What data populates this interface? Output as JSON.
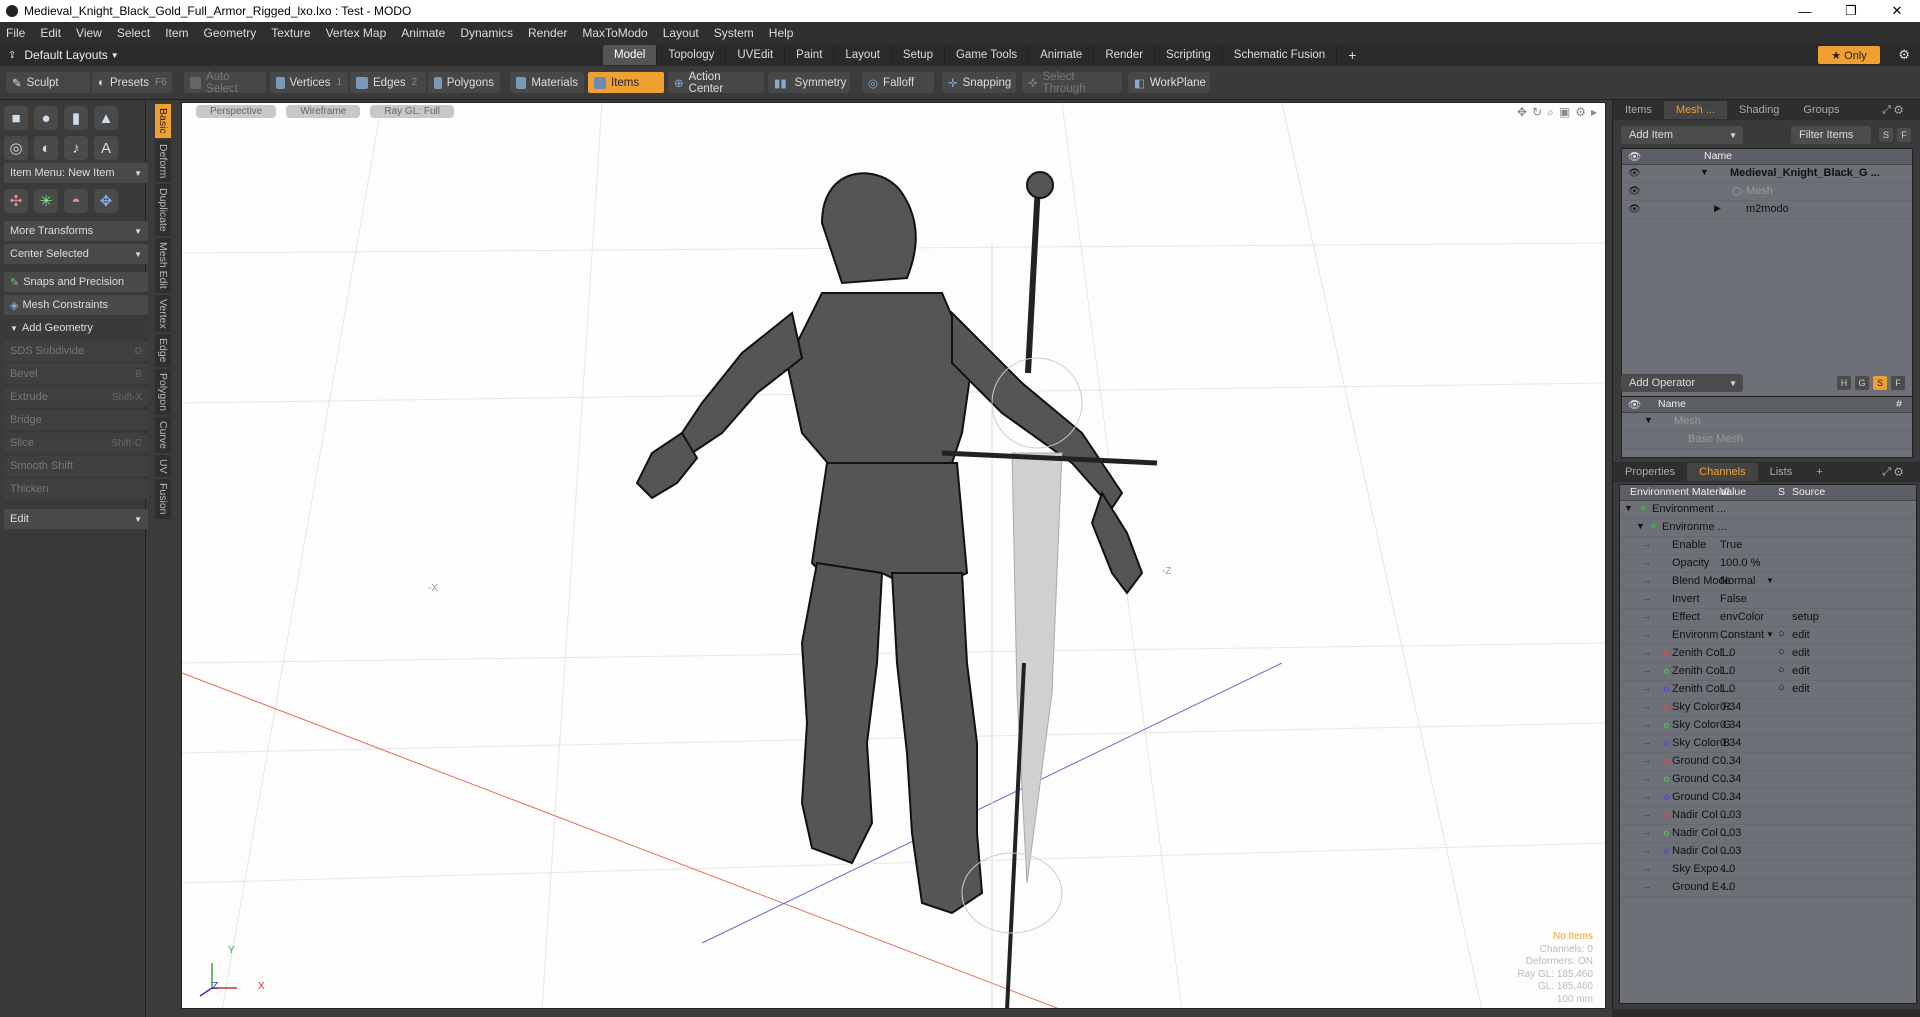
{
  "window": {
    "title": "Medieval_Knight_Black_Gold_Full_Armor_Rigged_lxo.lxo : Test - MODO",
    "minimize": "—",
    "maximize": "❐",
    "close": "✕"
  },
  "menu": [
    "File",
    "Edit",
    "View",
    "Select",
    "Item",
    "Geometry",
    "Texture",
    "Vertex Map",
    "Animate",
    "Dynamics",
    "Render",
    "MaxToModo",
    "Layout",
    "System",
    "Help"
  ],
  "layout": {
    "selector": "Default Layouts",
    "tabs": [
      "Model",
      "Topology",
      "UVEdit",
      "Paint",
      "Layout",
      "Setup",
      "Game Tools",
      "Animate",
      "Render",
      "Scripting",
      "Schematic Fusion"
    ],
    "active_tab": "Model",
    "add_tab": "+",
    "only_label": "★ Only"
  },
  "toolbar": {
    "sculpt": "Sculpt",
    "presets": "Presets",
    "presets_key": "F6",
    "auto_select": "Auto Select",
    "vertices": "Vertices",
    "vertices_num": "1",
    "edges": "Edges",
    "edges_num": "2",
    "polygons": "Polygons",
    "materials": "Materials",
    "items": "Items",
    "action_center": "Action Center",
    "symmetry": "Symmetry",
    "falloff": "Falloff",
    "snapping": "Snapping",
    "select_through": "Select Through",
    "workplane": "WorkPlane"
  },
  "left": {
    "item_menu": "Item Menu: New Item",
    "more_transforms": "More Transforms",
    "center_selected": "Center Selected",
    "snaps": "Snaps and Precision",
    "mesh_constraints": "Mesh Constraints",
    "add_geometry": "Add Geometry",
    "tools": [
      {
        "label": "SDS Subdivide",
        "key": "D"
      },
      {
        "label": "Bevel",
        "key": "B"
      },
      {
        "label": "Extrude",
        "key": "Shift-X"
      },
      {
        "label": "Bridge",
        "key": ""
      },
      {
        "label": "Slice",
        "key": "Shift-C"
      },
      {
        "label": "Smooth Shift",
        "key": ""
      },
      {
        "label": "Thicken",
        "key": ""
      }
    ],
    "edit": "Edit",
    "side_tabs": [
      "Basic",
      "Deform",
      "Duplicate",
      "Mesh Edit",
      "Vertex",
      "Edge",
      "Polygon",
      "Curve",
      "UV",
      "Fusion"
    ]
  },
  "viewport": {
    "buttons": [
      "Perspective",
      "Wireframe",
      "Ray GL: Full"
    ],
    "info": {
      "no_items": "No Items",
      "channels": "Channels: 0",
      "deformers": "Deformers: ON",
      "raygl": "Ray GL: 185,460",
      "gl": "GL: 185,460",
      "scale": "100 mm"
    },
    "axis_neg_x": "-X",
    "axis_neg_z": "-Z",
    "gizmo_y": "Y",
    "gizmo_z": "Z",
    "gizmo_x": "X"
  },
  "items_panel": {
    "tabs": [
      "Items",
      "Mesh ...",
      "Shading",
      "Groups"
    ],
    "active": "Mesh ...",
    "add_item": "Add Item",
    "filter_items": "Filter Items",
    "s": "S",
    "f": "F",
    "col_name": "Name",
    "rows": [
      {
        "label": "Medieval_Knight_Black_G ..."
      },
      {
        "label": "Mesh"
      },
      {
        "label": "m2modo"
      }
    ]
  },
  "operator_panel": {
    "add_operator": "Add Operator",
    "h": "H",
    "g": "G",
    "s": "S",
    "f": "F",
    "col_name": "Name",
    "col_hash": "#",
    "rows": [
      {
        "label": "Mesh"
      },
      {
        "label": "Base Mesh"
      }
    ]
  },
  "channels_panel": {
    "tabs": [
      "Properties",
      "Channels",
      "Lists"
    ],
    "active": "Channels",
    "add": "+",
    "headers": {
      "name": "Environment Material",
      "value": "Value",
      "s": "S",
      "source": "Source"
    },
    "tree": [
      {
        "label": "Environment ..."
      },
      {
        "label": "Environme ..."
      }
    ],
    "rows": [
      {
        "name": "Enable",
        "value": "True",
        "source": ""
      },
      {
        "name": "Opacity",
        "value": "100.0 %",
        "source": ""
      },
      {
        "name": "Blend Mode",
        "value": "Normal",
        "source": ""
      },
      {
        "name": "Invert",
        "value": "False",
        "source": ""
      },
      {
        "name": "Effect",
        "value": "envColor",
        "source": "setup"
      },
      {
        "name": "Environm ...",
        "value": "Constant",
        "source": "edit"
      },
      {
        "name": "Zenith Col...",
        "value": "1.0",
        "source": "edit"
      },
      {
        "name": "Zenith Col...",
        "value": "1.0",
        "source": "edit"
      },
      {
        "name": "Zenith Col...",
        "value": "1.0",
        "source": "edit"
      },
      {
        "name": "Sky Color R",
        "value": "0.34",
        "source": ""
      },
      {
        "name": "Sky Color G",
        "value": "0.34",
        "source": ""
      },
      {
        "name": "Sky Color B",
        "value": "0.34",
        "source": ""
      },
      {
        "name": "Ground C ...",
        "value": "0.34",
        "source": ""
      },
      {
        "name": "Ground C ...",
        "value": "0.34",
        "source": ""
      },
      {
        "name": "Ground C ...",
        "value": "0.34",
        "source": ""
      },
      {
        "name": "Nadir Col ...",
        "value": "0.03",
        "source": ""
      },
      {
        "name": "Nadir Col ...",
        "value": "0.03",
        "source": ""
      },
      {
        "name": "Nadir Col ...",
        "value": "0.03",
        "source": ""
      },
      {
        "name": "Sky Expo ...",
        "value": "4.0",
        "source": ""
      },
      {
        "name": "Ground E ...",
        "value": "4.0",
        "source": ""
      }
    ]
  },
  "colors": {
    "accent": "#f0a030",
    "panel": "#3a3a3a",
    "viewport": "#fdfdfd"
  }
}
